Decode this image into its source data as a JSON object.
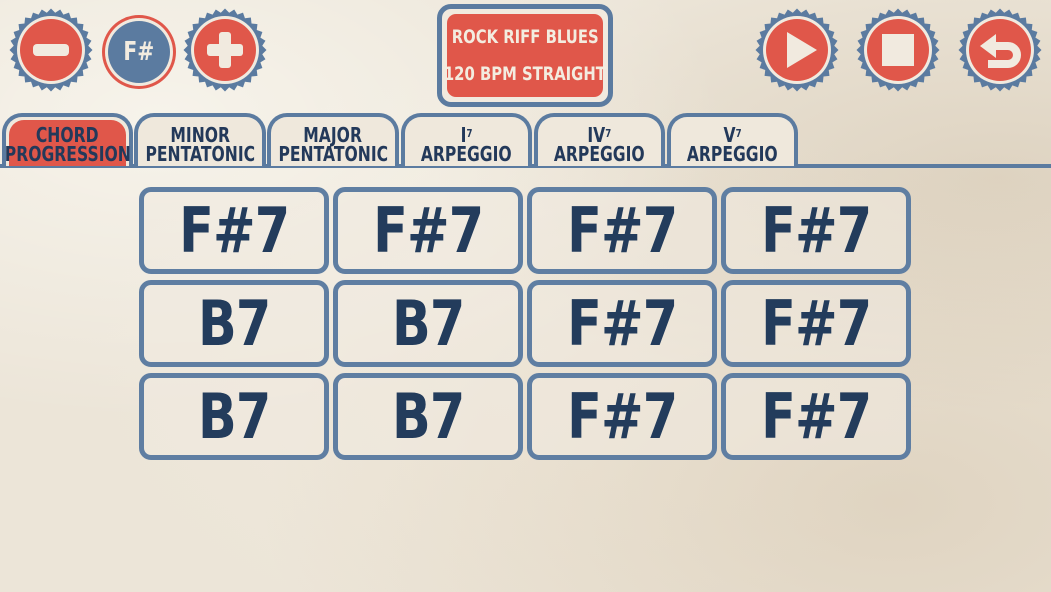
{
  "colors": {
    "red": "#e0574a",
    "blue": "#5b7ba0",
    "navy_text": "#233c5c",
    "cream": "#f1eadf",
    "paper": "#ece5d8"
  },
  "toolbar": {
    "minus_icon": "minus-icon",
    "key_label": "F#",
    "plus_icon": "plus-icon",
    "play_icon": "play-icon",
    "stop_icon": "stop-icon",
    "undo_icon": "undo-icon"
  },
  "title_panel": {
    "line1": "ROCK RIFF BLUES",
    "line2": "120 BPM STRAIGHT"
  },
  "tabs": [
    {
      "line1": "CHORD",
      "line1_sup": "",
      "line2": "PROGRESSION",
      "active": true
    },
    {
      "line1": "MINOR",
      "line1_sup": "",
      "line2": "PENTATONIC",
      "active": false
    },
    {
      "line1": "MAJOR",
      "line1_sup": "",
      "line2": "PENTATONIC",
      "active": false
    },
    {
      "line1": "I",
      "line1_sup": "7",
      "line2": "ARPEGGIO",
      "active": false
    },
    {
      "line1": "IV",
      "line1_sup": "7",
      "line2": "ARPEGGIO",
      "active": false
    },
    {
      "line1": "V",
      "line1_sup": "7",
      "line2": "ARPEGGIO",
      "active": false
    }
  ],
  "chord_grid": {
    "rows": [
      [
        "F#7",
        "F#7",
        "F#7",
        "F#7"
      ],
      [
        "B7",
        "B7",
        "F#7",
        "F#7"
      ],
      [
        "B7",
        "B7",
        "F#7",
        "F#7"
      ]
    ]
  }
}
